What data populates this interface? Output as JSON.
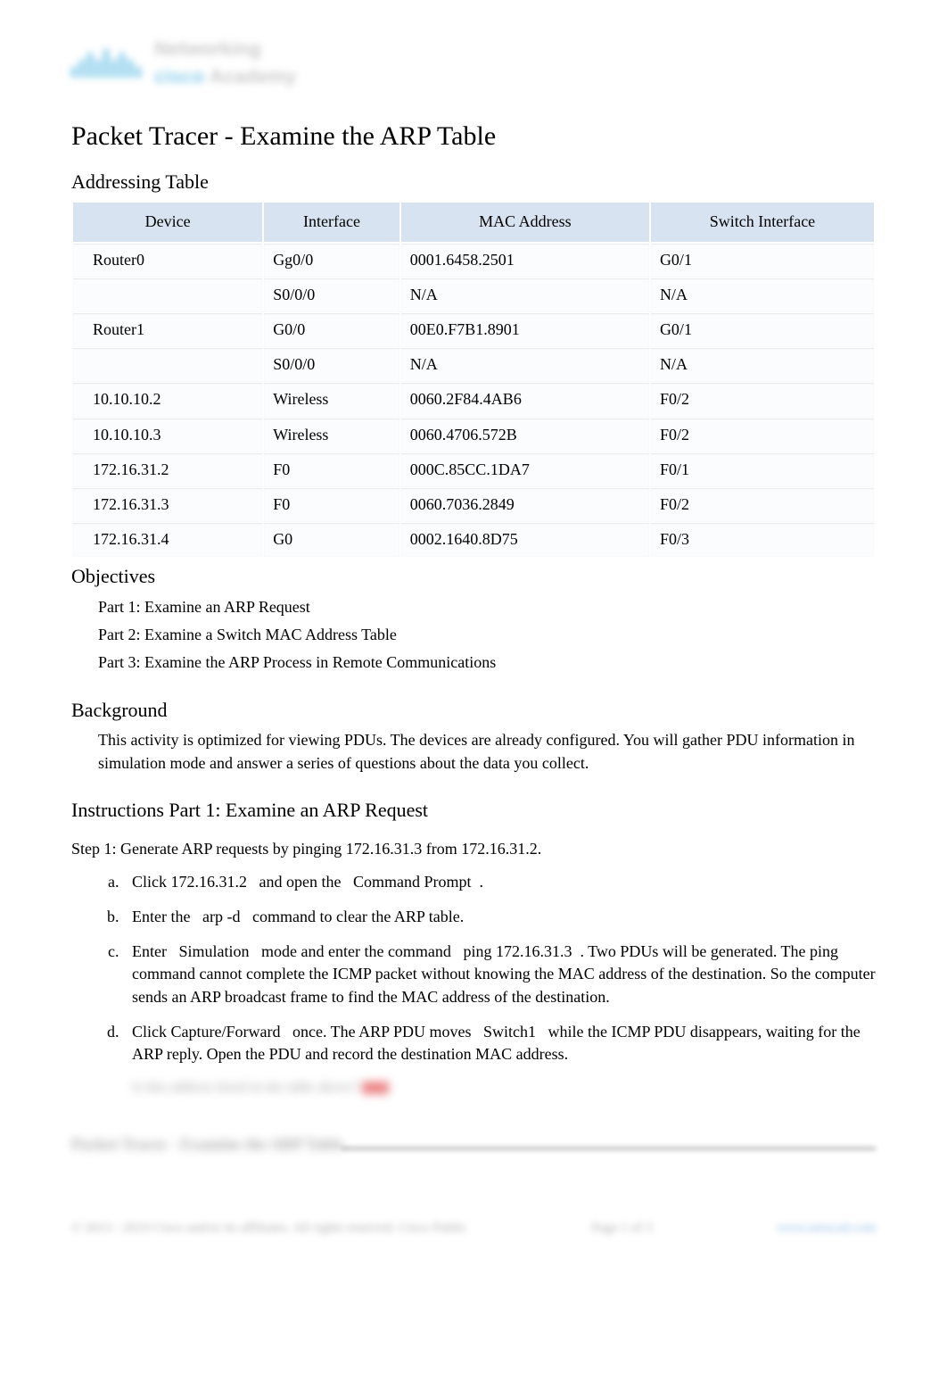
{
  "logo": {
    "brand": "cisco",
    "line1": "Networking",
    "line2": "Academy"
  },
  "title": "Packet Tracer - Examine the ARP Table",
  "addressing": {
    "heading": "Addressing Table",
    "headers": [
      "Device",
      "Interface",
      "MAC Address",
      "Switch Interface"
    ],
    "rows": [
      [
        "Router0",
        "Gg0/0",
        "0001.6458.2501",
        "G0/1"
      ],
      [
        "",
        "S0/0/0",
        "N/A",
        "N/A"
      ],
      [
        "Router1",
        "G0/0",
        "00E0.F7B1.8901",
        "G0/1"
      ],
      [
        "",
        "S0/0/0",
        "N/A",
        "N/A"
      ],
      [
        "10.10.10.2",
        "Wireless",
        "0060.2F84.4AB6",
        "F0/2"
      ],
      [
        "10.10.10.3",
        "Wireless",
        "0060.4706.572B",
        "F0/2"
      ],
      [
        "172.16.31.2",
        "F0",
        "000C.85CC.1DA7",
        "F0/1"
      ],
      [
        "172.16.31.3",
        "F0",
        "0060.7036.2849",
        "F0/2"
      ],
      [
        "172.16.31.4",
        "G0",
        "0002.1640.8D75",
        "F0/3"
      ]
    ]
  },
  "objectives": {
    "heading": "Objectives",
    "items": [
      "Part 1: Examine an ARP Request",
      "Part 2: Examine a Switch MAC Address Table",
      "Part 3: Examine the ARP Process in Remote Communications"
    ]
  },
  "background": {
    "heading": "Background",
    "text": "This activity is optimized for viewing PDUs. The devices are already configured. You will gather PDU information in simulation mode and answer a series of questions about the data you collect."
  },
  "instructions": {
    "heading": "Instructions Part 1: Examine an ARP Request",
    "step1_title": "Step 1: Generate ARP requests by pinging 172.16.31.3 from 172.16.31.2.",
    "steps": {
      "a": {
        "p1": "Click ",
        "b1": "172.16.31.2",
        "p2": " and open the ",
        "b2": "Command Prompt",
        "p3": "."
      },
      "b": {
        "p1": "Enter the ",
        "b1": "arp -d",
        "p2": " command to clear the ARP table."
      },
      "c": {
        "p1": "Enter ",
        "b1": "Simulation",
        "p2": " mode and enter the command ",
        "b2": "ping 172.16.31.3",
        "p3": ". Two PDUs will be generated. The ",
        "b3": "ping",
        "p4": " command cannot complete the ICMP packet without knowing the MAC address of the destination. So the computer sends an ARP broadcast frame to find the MAC address of the destination."
      },
      "d": {
        "p1": "Click ",
        "b1": "Capture/Forward",
        "p2": " once. The ARP PDU moves ",
        "b2": "Switch1",
        "p3": " while the ICMP PDU disappears, waiting for the ARP reply. Open the PDU and record the destination MAC address."
      }
    }
  },
  "blurred": {
    "question": "Is this address listed in the table above?",
    "doc_title": "Packet Tracer - Examine the ARP Table"
  },
  "footer": {
    "copyright": "© 2013 - 2019 Cisco and/or its affiliates. All rights reserved. Cisco Public",
    "page": "Page 1 of 3",
    "link": "www.netacad.com"
  }
}
